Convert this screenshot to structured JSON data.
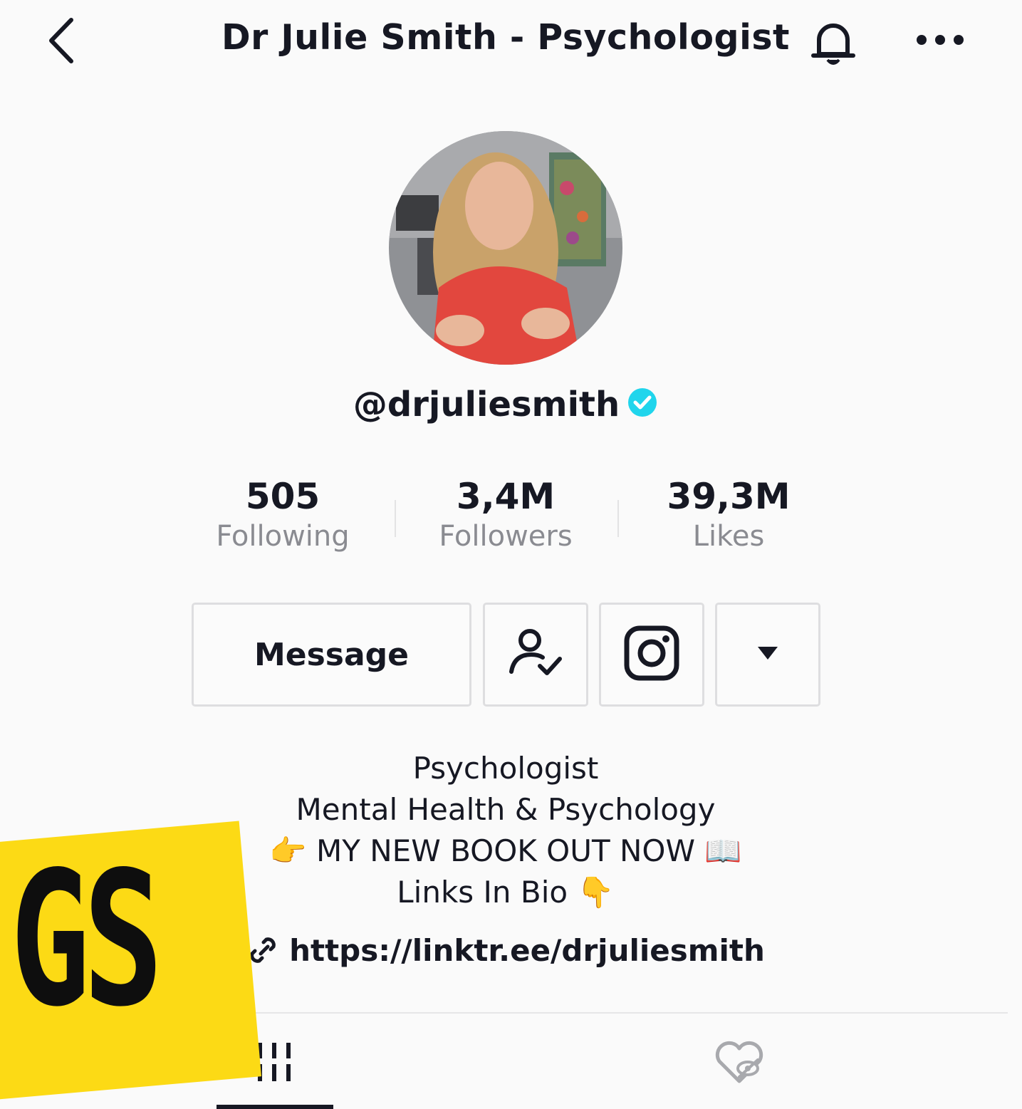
{
  "header": {
    "title": "Dr Julie Smith - Psychologist",
    "back_icon": "chevron-left-icon",
    "bell_icon": "bell-icon",
    "more_icon": "more-dots-icon"
  },
  "profile": {
    "username": "@drjuliesmith",
    "verified": true,
    "verified_color": "#20d5ec",
    "avatar_desc": "profile photo"
  },
  "stats": [
    {
      "value": "505",
      "label": "Following"
    },
    {
      "value": "3,4M",
      "label": "Followers"
    },
    {
      "value": "39,3M",
      "label": "Likes"
    }
  ],
  "actions": {
    "message_label": "Message",
    "following_icon": "user-check-icon",
    "instagram_icon": "instagram-icon",
    "dropdown_icon": "caret-down-icon"
  },
  "bio": {
    "line1": "Psychologist",
    "line2": "Mental Health & Psychology",
    "line3": "👉 MY NEW BOOK OUT NOW 📖",
    "line4": "Links In Bio 👇",
    "link": "https://linktr.ee/drjuliesmith"
  },
  "tabs": [
    {
      "icon": "videos-grid-icon",
      "active": true
    },
    {
      "icon": "liked-hidden-icon",
      "active": false
    }
  ],
  "overlay": {
    "label": "GS",
    "color": "#fcda15"
  }
}
